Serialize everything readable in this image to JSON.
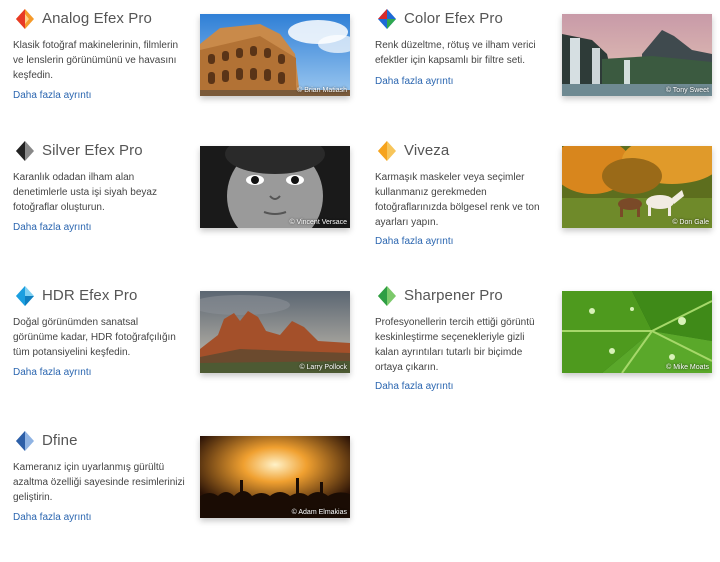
{
  "products": [
    {
      "id": "analog",
      "title": "Analog Efex Pro",
      "description": "Klasik fotoğraf makinelerinin, filmlerin ve lenslerin görünümünü ve havasını keşfedin.",
      "more_label": "Daha fazla ayrıntı",
      "credit": "© Brian Matiash",
      "icon": "analog-efex-logo-icon",
      "photo": "colosseum-photo",
      "colors": [
        "#e83a25",
        "#f59a2a"
      ]
    },
    {
      "id": "color",
      "title": "Color Efex Pro",
      "description": "Renk düzeltme, rötuş ve ilham verici efektler için kapsamlı bir filtre seti.",
      "more_label": "Daha fazla ayrıntı",
      "credit": "© Tony Sweet",
      "icon": "color-efex-logo-icon",
      "photo": "waterfall-photo",
      "colors": [
        "#1e6ad6",
        "#d92b2b"
      ]
    },
    {
      "id": "silver",
      "title": "Silver Efex Pro",
      "description": "Karanlık odadan ilham alan denetimlerle usta işi siyah beyaz fotoğraflar oluşturun.",
      "more_label": "Daha fazla ayrıntı",
      "credit": "© Vincent Versace",
      "icon": "silver-efex-logo-icon",
      "photo": "child-portrait-photo",
      "colors": [
        "#222222",
        "#888888"
      ]
    },
    {
      "id": "viveza",
      "title": "Viveza",
      "description": "Karmaşık maskeler veya seçimler kullanmanız gerekmeden fotoğraflarınızda bölgesel renk ve ton ayarları yapın.",
      "more_label": "Daha fazla ayrıntı",
      "credit": "© Don Gale",
      "icon": "viveza-logo-icon",
      "photo": "horses-photo",
      "colors": [
        "#f6a31d",
        "#f7c55a"
      ]
    },
    {
      "id": "hdr",
      "title": "HDR Efex Pro",
      "description": "Doğal görünümden sanatsal görünüme kadar, HDR fotoğrafçılığın tüm potansiyelini keşfedin.",
      "more_label": "Daha fazla ayrıntı",
      "credit": "© Larry Pollock",
      "icon": "hdr-efex-logo-icon",
      "photo": "red-rocks-photo",
      "colors": [
        "#1b9fe0",
        "#7fd0f2"
      ]
    },
    {
      "id": "sharpener",
      "title": "Sharpener Pro",
      "description": "Profesyonellerin tercih ettiği görüntü keskinleştirme seçenekleriyle gizli kalan ayrıntıları tutarlı bir biçimde ortaya çıkarın.",
      "more_label": "Daha fazla ayrıntı",
      "credit": "© Mike Moats",
      "icon": "sharpener-logo-icon",
      "photo": "green-leaf-photo",
      "colors": [
        "#2f9e44",
        "#7cc96b"
      ]
    },
    {
      "id": "dfine",
      "title": "Dfine",
      "description": "Kameranız için uyarlanmış gürültü azaltma özelliği sayesinde resimlerinizi geliştirin.",
      "more_label": "Daha fazla ayrıntı",
      "credit": "© Adam Elmakias",
      "icon": "dfine-logo-icon",
      "photo": "concert-crowd-photo",
      "colors": [
        "#2d5fa8",
        "#8fb3e3"
      ]
    }
  ]
}
